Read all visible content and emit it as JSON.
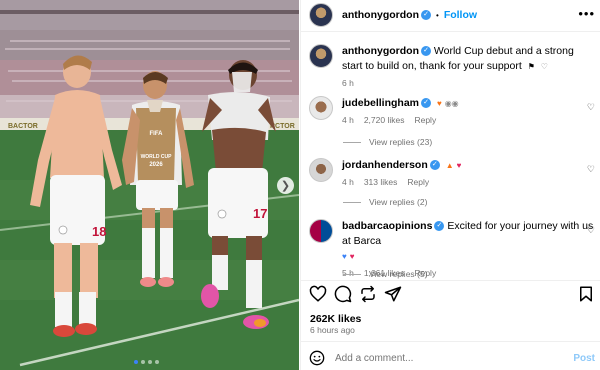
{
  "post": {
    "author": "anthonygordon",
    "follow_label": "Follow",
    "caption": "World Cup debut and a strong start to build on, thank for your support",
    "caption_time": "6 h",
    "likes": "262K likes",
    "time_ago": "6 hours ago"
  },
  "comments": [
    {
      "user": "judebellingham",
      "time": "4 h",
      "likes": "2,720 likes",
      "reply_label": "Reply",
      "view_replies": "View replies (23)"
    },
    {
      "user": "jordanhenderson",
      "time": "4 h",
      "likes": "313 likes",
      "reply_label": "Reply",
      "view_replies": "View replies (2)"
    },
    {
      "user": "badbarcaopinions",
      "text": "Excited for your journey with us at Barca",
      "time": "5 h",
      "likes": "1,661 likes",
      "reply_label": "Reply",
      "view_replies": "View replies (5)"
    }
  ],
  "add_comment": {
    "placeholder": "Add a comment...",
    "post_label": "Post"
  },
  "photo": {
    "shirt_numbers": [
      "18",
      "17"
    ],
    "bib_text": [
      "FIFA",
      "WORLD CUP",
      "2026"
    ]
  },
  "carousel": {
    "count": 4,
    "active": 1
  },
  "colors": {
    "accent": "#0095f6",
    "verified": "#3897f0",
    "pitch": "#3d6e3a"
  }
}
